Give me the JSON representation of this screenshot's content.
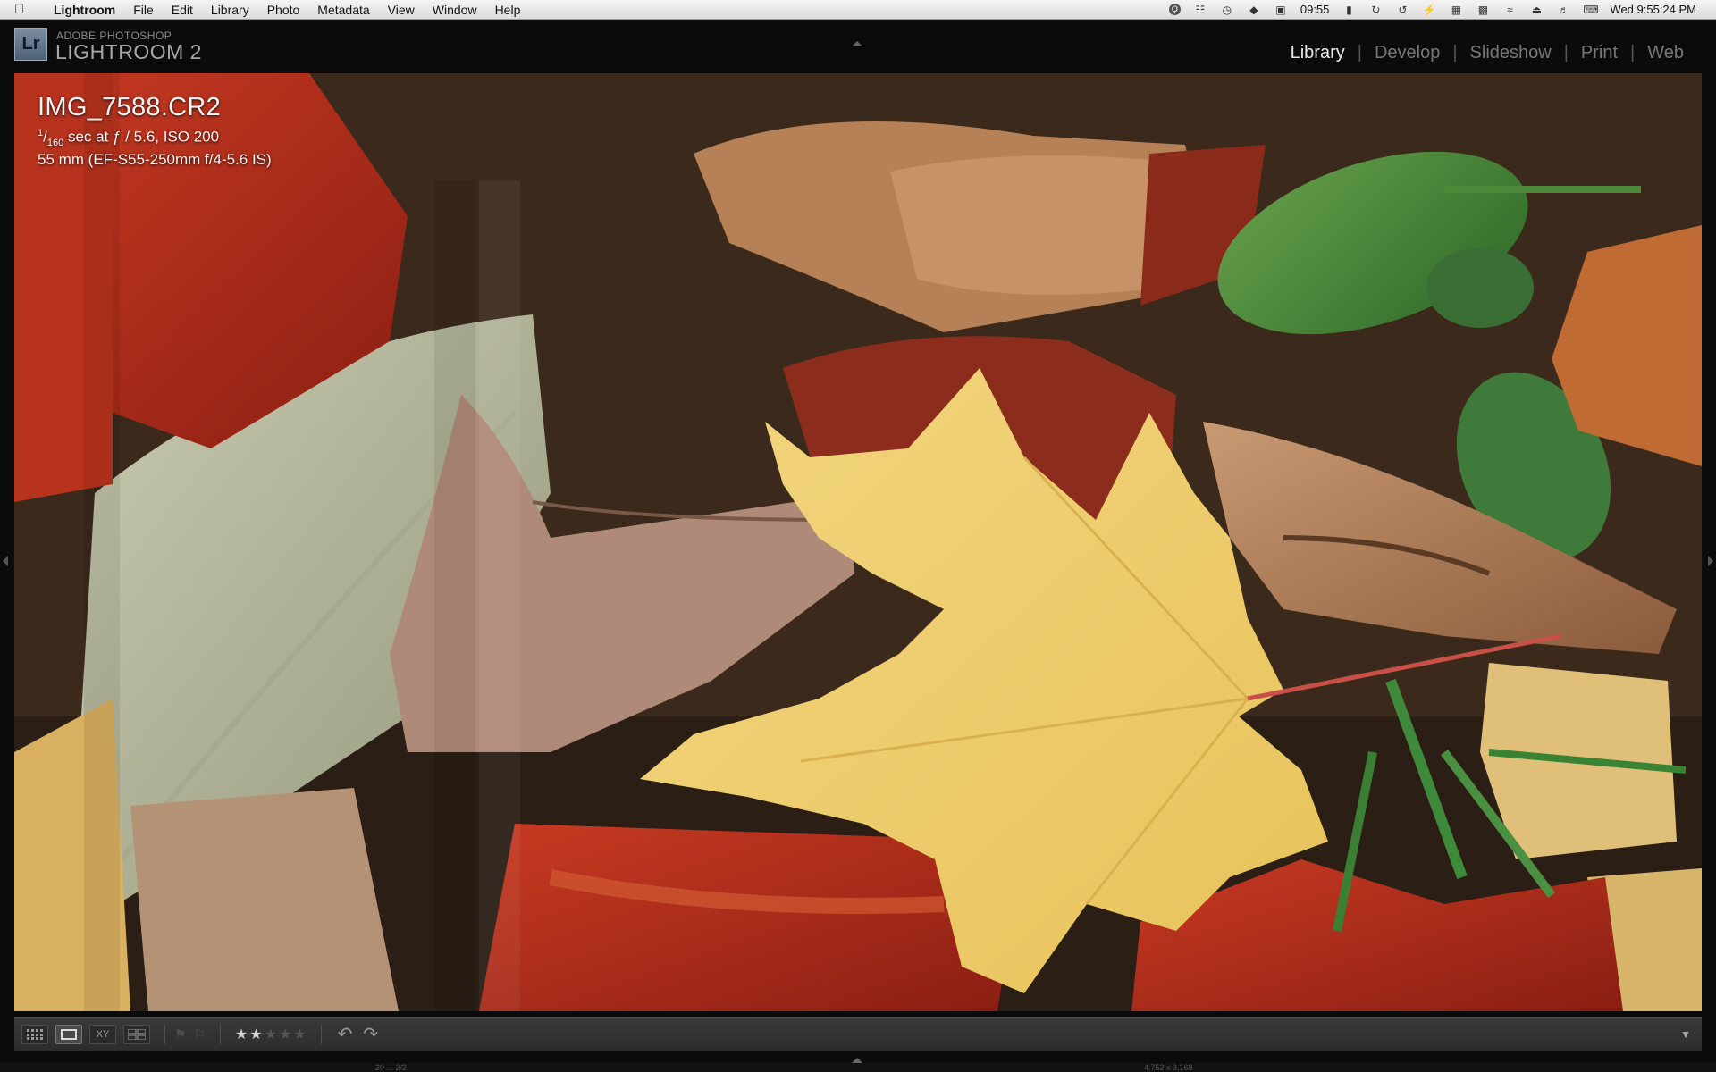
{
  "menubar": {
    "app_name": "Lightroom",
    "menus": [
      "File",
      "Edit",
      "Library",
      "Photo",
      "Metadata",
      "View",
      "Window",
      "Help"
    ],
    "clock_widget": "09:55",
    "datetime": "Wed 9:55:24 PM",
    "status_icons": [
      "quicksilver-icon",
      "dictionary-icon",
      "time-machine-icon",
      "drop-icon",
      "calendar-icon",
      "cpu-meter-icon",
      "sync-icon",
      "backup-icon",
      "power-icon",
      "network-icon",
      "display-icon",
      "wifi-icon",
      "eject-icon",
      "volume-icon",
      "keyboard-icon"
    ]
  },
  "identity": {
    "logo_text": "Lr",
    "brand_top": "ADOBE PHOTOSHOP",
    "brand_main": "LIGHTROOM 2"
  },
  "modules": [
    {
      "label": "Library",
      "active": true
    },
    {
      "label": "Develop",
      "active": false
    },
    {
      "label": "Slideshow",
      "active": false
    },
    {
      "label": "Print",
      "active": false
    },
    {
      "label": "Web",
      "active": false
    }
  ],
  "loupe": {
    "filename": "IMG_7588.CR2",
    "shutter_numerator": "1",
    "shutter_denominator": "160",
    "exposure_rest": " sec at ƒ / 5.6, ISO 200",
    "lens_info": "55 mm (EF-S55-250mm f/4-5.6 IS)"
  },
  "toolbar": {
    "view_buttons": [
      {
        "name": "grid-view-button",
        "icon": "grid-icon",
        "active": false
      },
      {
        "name": "loupe-view-button",
        "icon": "loupe-icon",
        "active": true
      },
      {
        "name": "compare-view-button",
        "icon": "compare-icon",
        "active": false,
        "label": "XY"
      },
      {
        "name": "survey-view-button",
        "icon": "survey-icon",
        "active": false
      }
    ],
    "rating": 2,
    "rating_max": 5,
    "star_glyph": "★",
    "rotate_left_glyph": "↶",
    "rotate_right_glyph": "↷",
    "menu_glyph": "▼"
  },
  "filmstrip_fragments": [
    "20 ... 2/2",
    "4,752 x 3,168"
  ]
}
